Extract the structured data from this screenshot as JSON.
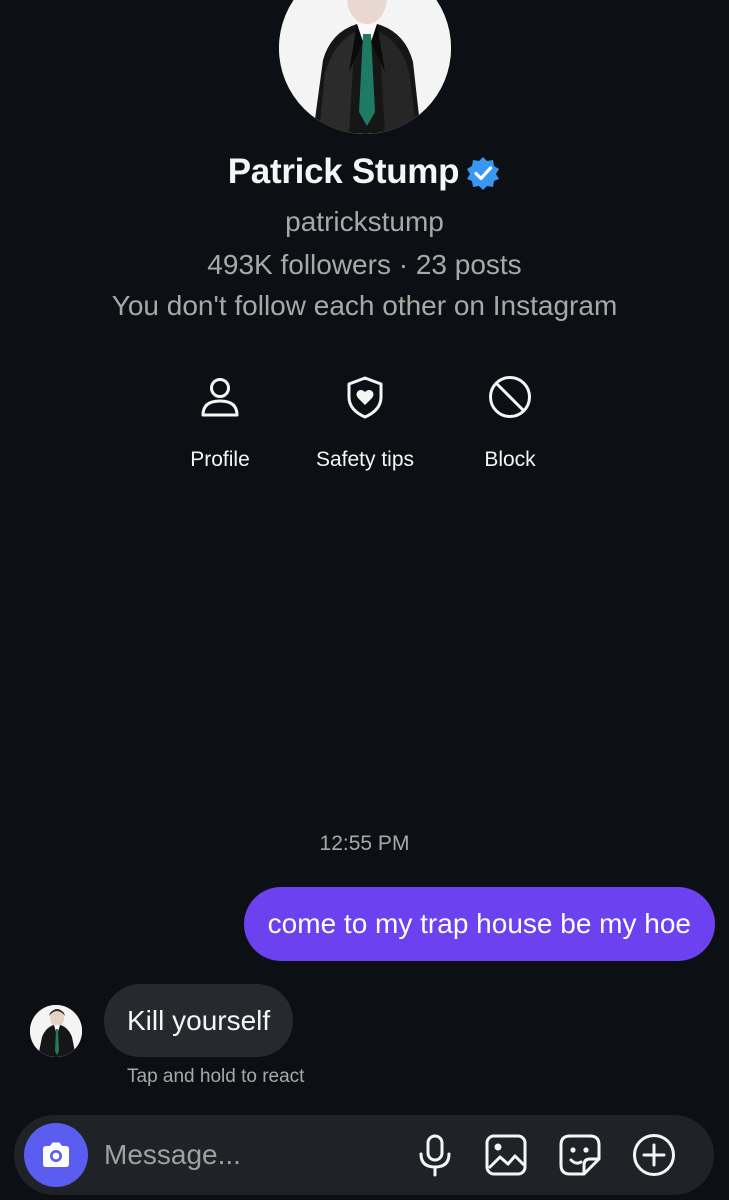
{
  "profile": {
    "name": "Patrick Stump",
    "handle": "patrickstump",
    "stats": "493K followers · 23 posts",
    "follow_note": "You don't follow each other on Instagram"
  },
  "actions": [
    {
      "label": "Profile",
      "icon": "person-icon"
    },
    {
      "label": "Safety tips",
      "icon": "shield-heart-icon"
    },
    {
      "label": "Block",
      "icon": "block-icon"
    }
  ],
  "conversation": {
    "timestamp": "12:55 PM",
    "messages": [
      {
        "direction": "outgoing",
        "text": "come to my trap house be my hoe"
      },
      {
        "direction": "incoming",
        "text": "Kill yourself"
      }
    ],
    "react_hint": "Tap and hold to react"
  },
  "composer": {
    "placeholder": "Message...",
    "tools": [
      "camera-icon",
      "microphone-icon",
      "gallery-icon",
      "sticker-icon",
      "plus-icon"
    ]
  },
  "colors": {
    "background": "#0c1014",
    "outgoing_bubble": "#6b41f0",
    "incoming_bubble": "#262a2f",
    "verified": "#3897f0",
    "camera_button": "#5b5cf0"
  }
}
